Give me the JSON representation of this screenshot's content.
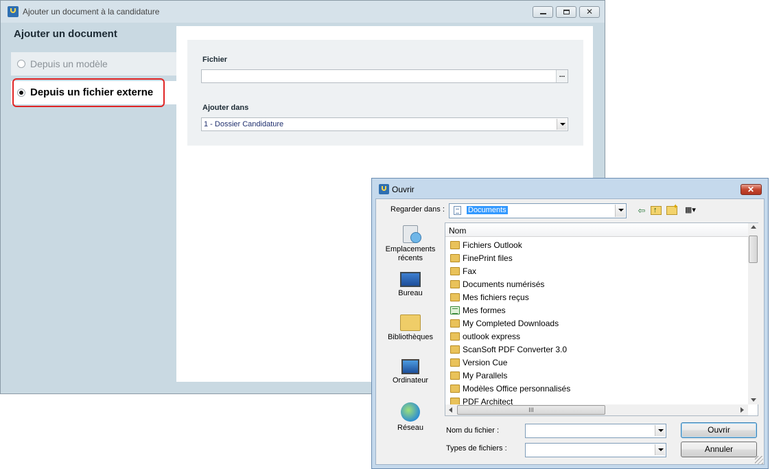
{
  "main_window": {
    "title": "Ajouter un document à la candidature",
    "heading": "Ajouter un document",
    "options": {
      "template": "Depuis un modèle",
      "external": "Depuis un fichier externe"
    },
    "selected_option": "external",
    "file_label": "Fichier",
    "file_value": "",
    "browse_label": "...",
    "add_in_label": "Ajouter dans",
    "add_in_value": "1 - Dossier Candidature"
  },
  "open_dialog": {
    "title": "Ouvrir",
    "look_in_label": "Regarder dans :",
    "look_in_value": "Documents",
    "places": {
      "recent": "Emplacements récents",
      "desktop": "Bureau",
      "libraries": "Bibliothèques",
      "computer": "Ordinateur",
      "network": "Réseau"
    },
    "column_name": "Nom",
    "files": [
      {
        "name": "Fichiers Outlook",
        "icon": "folder-icon"
      },
      {
        "name": "FinePrint files",
        "icon": "folder-icon"
      },
      {
        "name": "Fax",
        "icon": "folder-icon"
      },
      {
        "name": "Documents numérisés",
        "icon": "folder-icon"
      },
      {
        "name": "Mes fichiers reçus",
        "icon": "folder-icon"
      },
      {
        "name": "Mes formes",
        "icon": "form-file-icon"
      },
      {
        "name": "My Completed Downloads",
        "icon": "folder-icon"
      },
      {
        "name": "outlook express",
        "icon": "folder-icon"
      },
      {
        "name": "ScanSoft PDF Converter 3.0",
        "icon": "folder-icon"
      },
      {
        "name": "Version Cue",
        "icon": "folder-icon"
      },
      {
        "name": "My Parallels",
        "icon": "folder-icon"
      },
      {
        "name": "Modèles Office personnalisés",
        "icon": "folder-icon"
      },
      {
        "name": "PDF Architect",
        "icon": "folder-icon"
      }
    ],
    "hscroll_grip": "III",
    "file_name_label": "Nom du fichier :",
    "file_name_value": "",
    "file_types_label": "Types de fichiers :",
    "file_types_value": "",
    "open_button": "Ouvrir",
    "cancel_button": "Annuler"
  }
}
